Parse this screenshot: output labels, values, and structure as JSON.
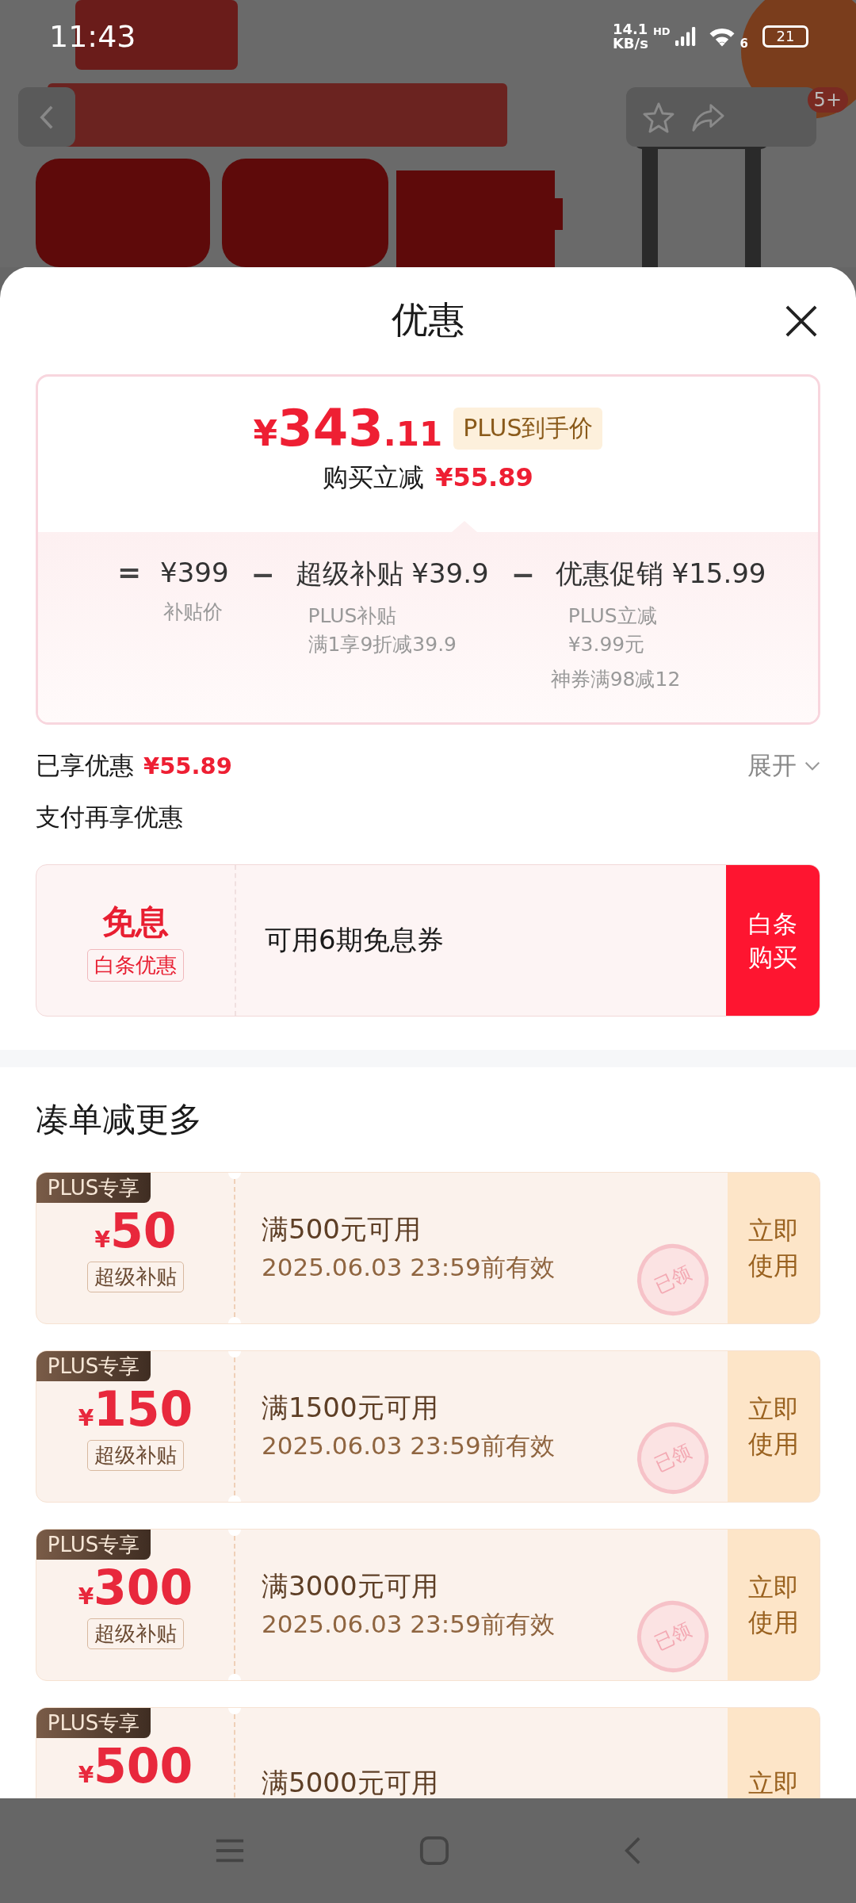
{
  "status_bar": {
    "time": "11:43",
    "net_speed": "14.1",
    "net_unit": "KB/s",
    "network": "HD",
    "wifi_label": "6",
    "battery": "21"
  },
  "hero": {
    "kind": "picture",
    "badge": "5+"
  },
  "sheet": {
    "title": "优惠"
  },
  "price_card": {
    "currency": "¥",
    "price_main": "343",
    "price_decimal": ".11",
    "price_tag": "PLUS到手价",
    "saving_label": "购买立减",
    "saving_amount": "¥55.89",
    "breakdown": [
      {
        "operator": "=",
        "label": "¥399",
        "notes": [
          "补贴价"
        ]
      },
      {
        "operator": "−",
        "label": "超级补贴 ¥39.9",
        "notes": [
          "PLUS补贴",
          "满1享9折减39.9"
        ]
      },
      {
        "operator": "−",
        "label": "优惠促销 ¥15.99",
        "notes": [
          "PLUS立减",
          "¥3.99元",
          "神券满98减12"
        ]
      }
    ]
  },
  "summary": {
    "label": "已享优惠",
    "amount": "¥55.89",
    "toggle": "展开",
    "expanded": false
  },
  "pay_section": {
    "title": "支付再享优惠",
    "offer": {
      "headline": "免息",
      "tag": "白条优惠",
      "description": "可用6期免息券",
      "button": [
        "白条",
        "购买"
      ]
    }
  },
  "more_section": {
    "title": "凑单减更多",
    "coupons": [
      {
        "tag": "PLUS专享",
        "currency": "¥",
        "amount": "50",
        "badge": "超级补贴",
        "condition": "满500元可用",
        "validity": "2025.06.03 23:59前有效",
        "action": [
          "立即",
          "使用"
        ],
        "stamp": "已领"
      },
      {
        "tag": "PLUS专享",
        "currency": "¥",
        "amount": "150",
        "badge": "超级补贴",
        "condition": "满1500元可用",
        "validity": "2025.06.03 23:59前有效",
        "action": [
          "立即",
          "使用"
        ],
        "stamp": "已领"
      },
      {
        "tag": "PLUS专享",
        "currency": "¥",
        "amount": "300",
        "badge": "超级补贴",
        "condition": "满3000元可用",
        "validity": "2025.06.03 23:59前有效",
        "action": [
          "立即",
          "使用"
        ],
        "stamp": "已领"
      },
      {
        "tag": "PLUS专享",
        "currency": "¥",
        "amount": "500",
        "condition": "满5000元可用",
        "action": [
          "立即"
        ]
      }
    ]
  }
}
